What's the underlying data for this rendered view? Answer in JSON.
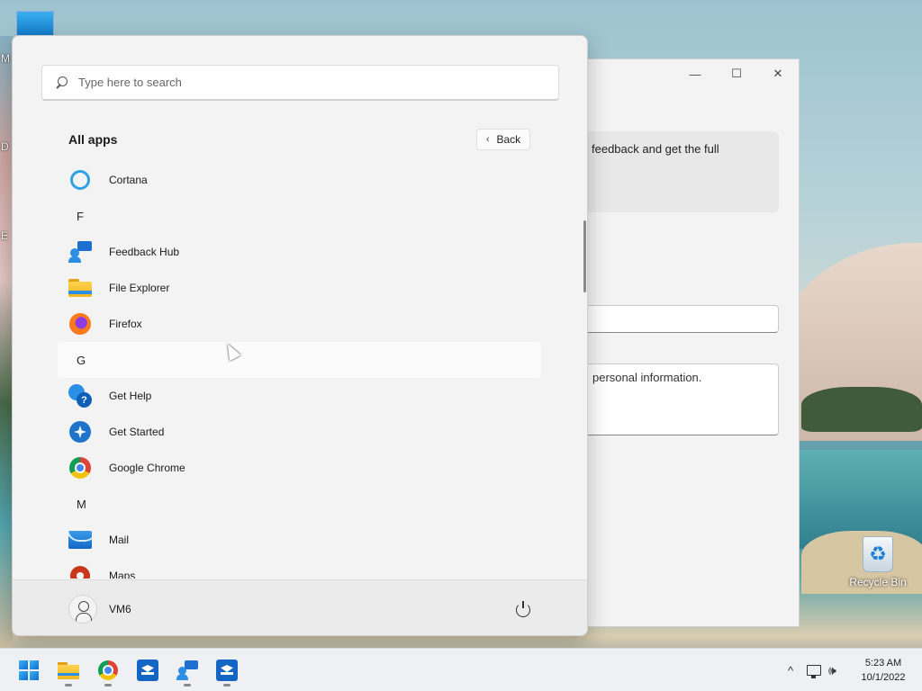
{
  "desktop": {
    "left_edge_letters": [
      "M",
      "D",
      "E"
    ],
    "recycle_bin_label": "Recycle Bin"
  },
  "background_window": {
    "controls": {
      "minimize": "—",
      "maximize": "☐",
      "close": "✕"
    },
    "card_text": "feedback and get the full",
    "privacy_text": "personal information."
  },
  "start_menu": {
    "search": {
      "placeholder": "Type here to search",
      "value": ""
    },
    "section_title": "All apps",
    "back_label": "Back",
    "items": [
      {
        "type": "app",
        "label": "Cortana",
        "icon": "cortana-icon"
      },
      {
        "type": "letter",
        "label": "F"
      },
      {
        "type": "app",
        "label": "Feedback Hub",
        "icon": "feedback-hub-icon"
      },
      {
        "type": "app",
        "label": "File Explorer",
        "icon": "file-explorer-icon"
      },
      {
        "type": "app",
        "label": "Firefox",
        "icon": "firefox-icon"
      },
      {
        "type": "letter",
        "label": "G"
      },
      {
        "type": "app",
        "label": "Get Help",
        "icon": "get-help-icon"
      },
      {
        "type": "app",
        "label": "Get Started",
        "icon": "get-started-icon"
      },
      {
        "type": "app",
        "label": "Google Chrome",
        "icon": "chrome-icon"
      },
      {
        "type": "letter",
        "label": "M"
      },
      {
        "type": "app",
        "label": "Mail",
        "icon": "mail-icon"
      },
      {
        "type": "app",
        "label": "Maps",
        "icon": "maps-icon"
      }
    ],
    "user_name": "VM6"
  },
  "taskbar": {
    "apps": [
      {
        "name": "start",
        "icon": "windows-logo-icon"
      },
      {
        "name": "file-explorer",
        "icon": "folder-icon",
        "running": true
      },
      {
        "name": "chrome",
        "icon": "chrome-icon",
        "running": true
      },
      {
        "name": "app-box-1",
        "icon": "box-app-icon",
        "running": false
      },
      {
        "name": "feedback-hub",
        "icon": "feedback-hub-icon",
        "running": true
      },
      {
        "name": "app-box-2",
        "icon": "box-app-icon",
        "running": true
      }
    ],
    "tray": {
      "chevron": "^",
      "volume": "🕪"
    },
    "clock": {
      "time": "5:23 AM",
      "date": "10/1/2022"
    }
  },
  "colors": {
    "accent": "#0a6fd1",
    "menu_bg": "#f3f3f3",
    "taskbar_bg": "#eef0f3"
  }
}
